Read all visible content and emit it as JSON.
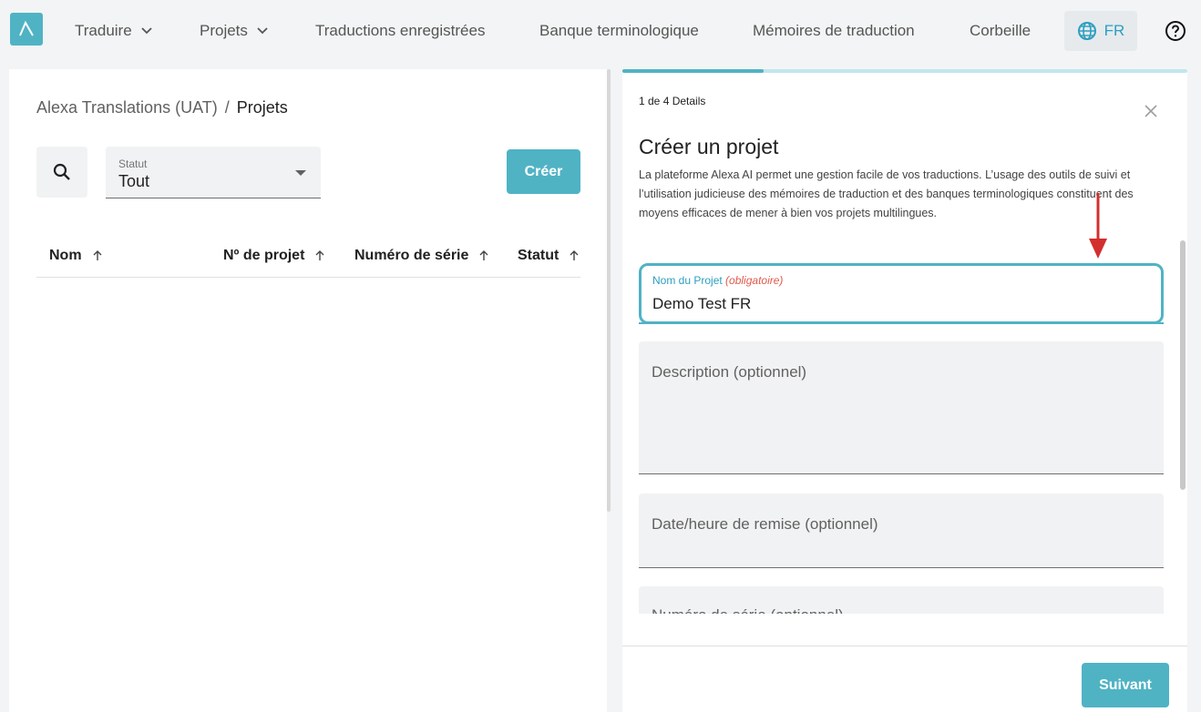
{
  "nav": {
    "items": [
      {
        "label": "Traduire",
        "has_dropdown": true
      },
      {
        "label": "Projets",
        "has_dropdown": true
      },
      {
        "label": "Traductions enregistrées",
        "has_dropdown": false
      },
      {
        "label": "Banque terminologique",
        "has_dropdown": false
      },
      {
        "label": "Mémoires de traduction",
        "has_dropdown": false
      },
      {
        "label": "Corbeille",
        "has_dropdown": false
      }
    ],
    "language": "FR",
    "icons": {
      "logo": "lambda-logo-icon",
      "language": "globe-icon",
      "help": "help-circle-icon"
    }
  },
  "left": {
    "breadcrumb": {
      "org": "Alexa Translations (UAT)",
      "separator": "/",
      "current": "Projets"
    },
    "status_filter": {
      "label": "Statut",
      "value": "Tout"
    },
    "create_label": "Créer",
    "columns": [
      "Nom",
      "Nº de projet",
      "Numéro de série",
      "Statut"
    ]
  },
  "dialog": {
    "step": "1 de 4 Details",
    "progress": 0.25,
    "title": "Créer un projet",
    "description": "La plateforme Alexa AI permet une gestion facile de vos traductions. L’usage des outils de suivi et l’utilisation judicieuse des mémoires de traduction et des banques terminologiques constituent des moyens efficaces de mener à bien vos projets multilingues.",
    "project_name": {
      "label": "Nom du Projet",
      "required": "(obligatoire)",
      "value": "Demo Test FR"
    },
    "description_placeholder": "Description (optionnel)",
    "due_date_placeholder": "Date/heure de remise (optionnel)",
    "serial_placeholder": "Numéro de série (optionnel)",
    "next_label": "Suivant"
  },
  "colors": {
    "accent": "#4fb3c4",
    "link": "#2c9fc0",
    "required": "#e0594a",
    "annotation": "#d32f2f"
  }
}
